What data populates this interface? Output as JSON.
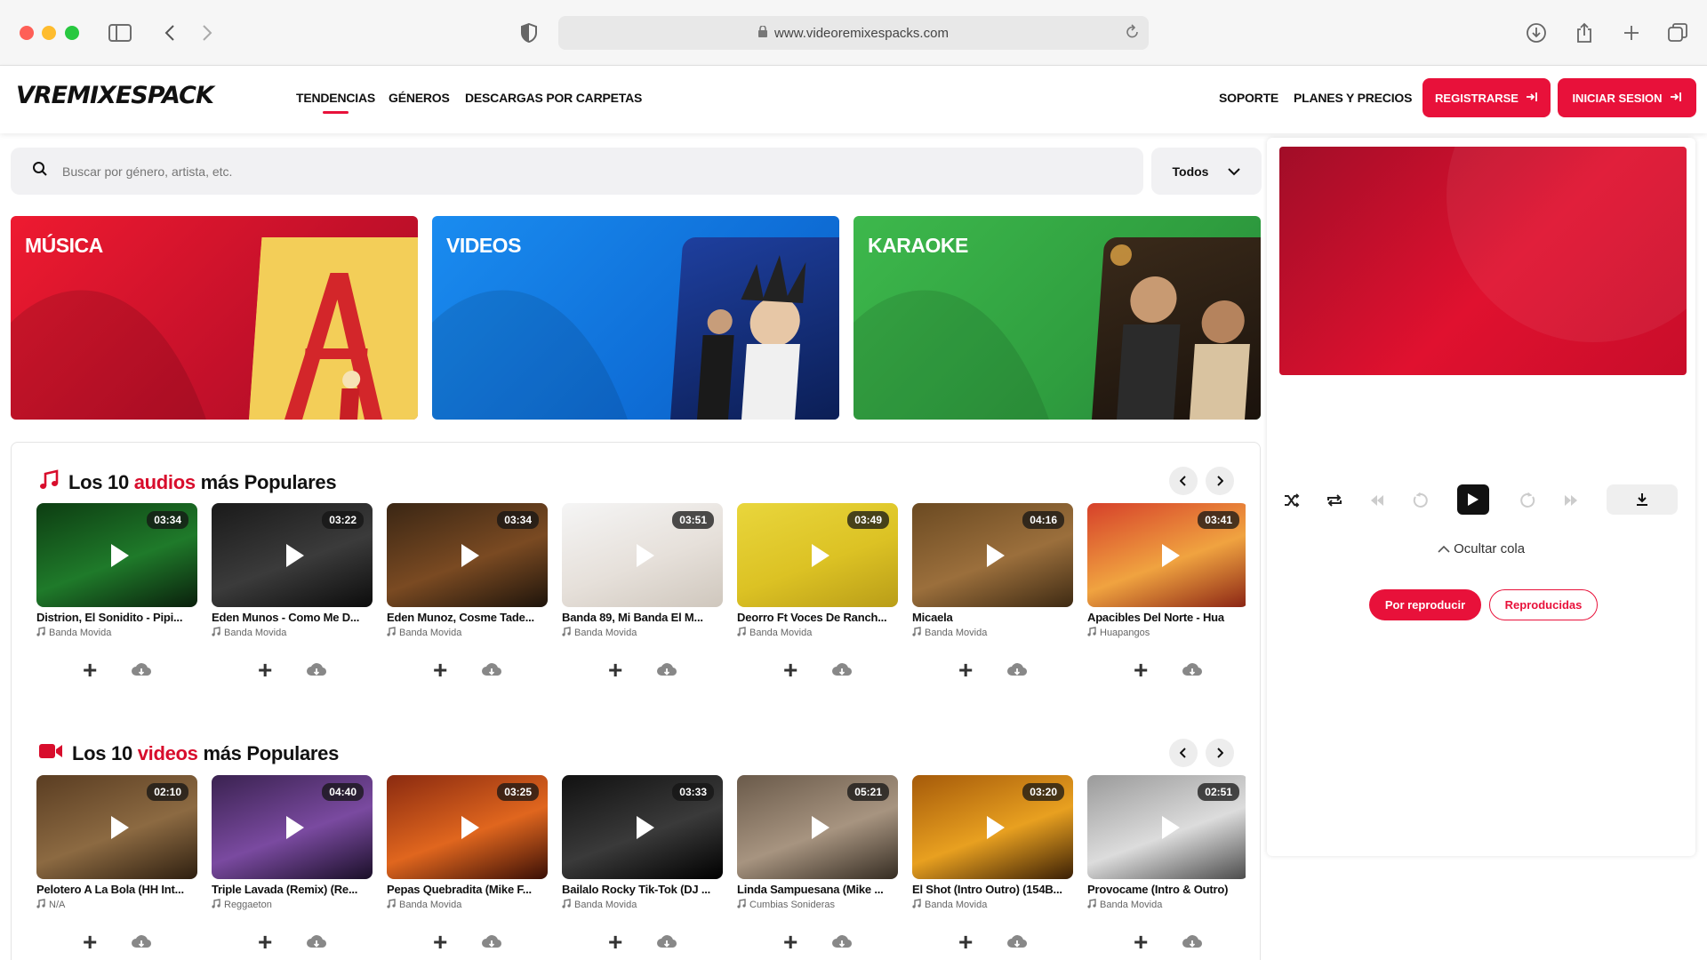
{
  "browser": {
    "url": "www.videoremixespacks.com"
  },
  "site": {
    "logo": "VREMIXESPACK",
    "nav": [
      "TENDENCIAS",
      "GÉNEROS",
      "DESCARGAS POR CARPETAS"
    ],
    "nav_right": [
      "SOPORTE",
      "PLANES Y PRECIOS"
    ],
    "register_label": "REGISTRARSE",
    "login_label": "INICIAR SESION"
  },
  "search": {
    "placeholder": "Buscar por género, artista, etc.",
    "filter": "Todos"
  },
  "categories": [
    "MÚSICA",
    "VIDEOS",
    "KARAOKE"
  ],
  "player": {
    "hide_queue": "Ocultar cola",
    "tab_pending": "Por reproducir",
    "tab_played": "Reproducidas"
  },
  "audios": {
    "title_pre": "Los 10",
    "title_accent": "audios",
    "title_post": "más Populares",
    "items": [
      {
        "title": "Distrion, El Sonidito - Pipi...",
        "genre": "Banda Movida",
        "duration": "03:34"
      },
      {
        "title": "Eden Munos - Como Me D...",
        "genre": "Banda Movida",
        "duration": "03:22"
      },
      {
        "title": "Eden Munoz, Cosme Tade...",
        "genre": "Banda Movida",
        "duration": "03:34"
      },
      {
        "title": "Banda 89, Mi Banda El M...",
        "genre": "Banda Movida",
        "duration": "03:51"
      },
      {
        "title": "Deorro Ft Voces De Ranch...",
        "genre": "Banda Movida",
        "duration": "03:49"
      },
      {
        "title": "Micaela",
        "genre": "Banda Movida",
        "duration": "04:16"
      },
      {
        "title": "Apacibles Del Norte - Hua",
        "genre": "Huapangos",
        "duration": "03:41"
      }
    ]
  },
  "videos": {
    "title_pre": "Los 10",
    "title_accent": "videos",
    "title_post": "más Populares",
    "items": [
      {
        "title": "Pelotero A La Bola (HH Int...",
        "genre": "N/A",
        "duration": "02:10"
      },
      {
        "title": "Triple Lavada (Remix) (Re...",
        "genre": "Reggaeton",
        "duration": "04:40"
      },
      {
        "title": "Pepas Quebradita (Mike F...",
        "genre": "Banda Movida",
        "duration": "03:25"
      },
      {
        "title": "Bailalo Rocky Tik-Tok (DJ ...",
        "genre": "Banda Movida",
        "duration": "03:33"
      },
      {
        "title": "Linda Sampuesana (Mike ...",
        "genre": "Cumbias Sonideras",
        "duration": "05:21"
      },
      {
        "title": "El Shot (Intro Outro) (154B...",
        "genre": "Banda Movida",
        "duration": "03:20"
      },
      {
        "title": "Provocame (Intro & Outro)",
        "genre": "Banda Movida",
        "duration": "02:51"
      }
    ]
  },
  "colors": {
    "brand_red": "#e8113a",
    "blue": "#0f6fd8",
    "green": "#2f9e3f"
  }
}
